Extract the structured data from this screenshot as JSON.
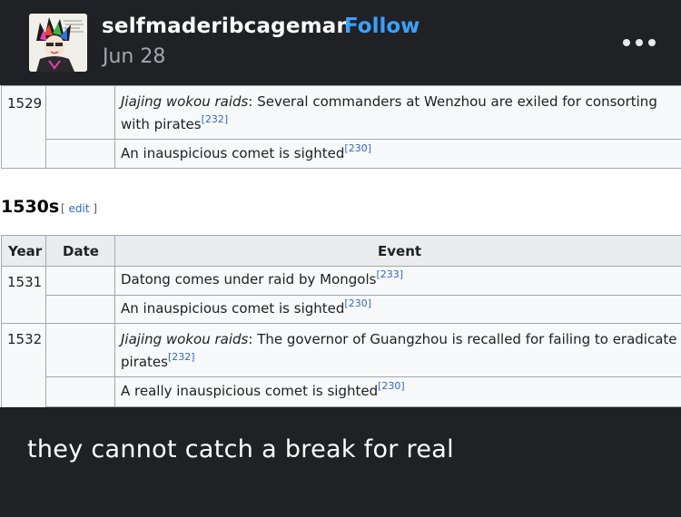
{
  "post": {
    "username": "selfmaderibcageman",
    "follow_label": "Follow",
    "date": "Jun 28",
    "caption": "they cannot catch a break for real"
  },
  "wiki": {
    "table1": {
      "rows": [
        {
          "year": "1529",
          "event_italic": "Jiajing wokou raids",
          "event_text_line1": ": Several commanders at Wenzhou are exiled for consorting",
          "event_text_line2": "with pirates",
          "ref": "[232]"
        },
        {
          "event_text": "An inauspicious comet is sighted",
          "ref": "[230]"
        }
      ]
    },
    "section_heading": "1530s",
    "edit_open": "[",
    "edit_label": "edit",
    "edit_close": "]",
    "table2": {
      "headers": [
        "Year",
        "Date",
        "Event"
      ],
      "rows": [
        {
          "year": "1531",
          "event_text": "Datong comes under raid by Mongols",
          "ref": "[233]"
        },
        {
          "event_text": "An inauspicious comet is sighted",
          "ref": "[230]"
        },
        {
          "year": "1532",
          "event_italic": "Jiajing wokou raids",
          "event_text_line1": ": The governor of Guangzhou is recalled for failing to eradicate",
          "event_text_line2": "pirates",
          "ref": "[232]"
        },
        {
          "event_text": "A really inauspicious comet is sighted",
          "ref": "[230]"
        }
      ]
    }
  },
  "colors": {
    "background": "#202124",
    "follow": "#3aa0ff",
    "link": "#3366cc",
    "table_border": "#a2a9b1"
  }
}
